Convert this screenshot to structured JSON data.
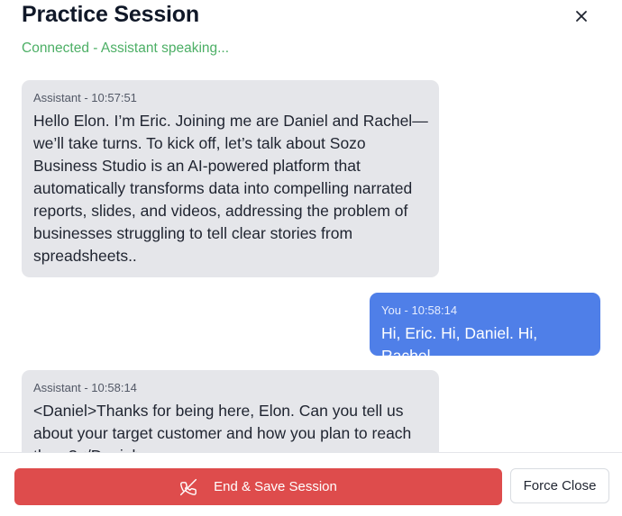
{
  "header": {
    "title": "Practice Session",
    "status": "Connected - Assistant speaking..."
  },
  "messages": [
    {
      "role": "assistant",
      "meta": "Assistant - 10:57:51",
      "text": "Hello Elon. I’m Eric. Joining me are Daniel and Rachel—\nwe’ll take turns. To kick off, let’s talk about Sozo\nBusiness Studio is an AI-powered platform that\nautomatically transforms data into compelling narrated\nreports, slides, and videos, addressing the problem of\nbusinesses struggling to tell clear stories from\nspreadsheets.."
    },
    {
      "role": "user",
      "meta": "You - 10:58:14",
      "text": "Hi, Eric. Hi, Daniel. Hi, Rachel."
    },
    {
      "role": "assistant",
      "meta": "Assistant - 10:58:14",
      "text": "<Daniel>Thanks for being here, Elon. Can you tell us\nabout your target customer and how you plan to reach\nthem?</Daniel>"
    }
  ],
  "footer": {
    "end_label": "End & Save Session",
    "force_label": "Force Close"
  },
  "colors": {
    "status_green": "#4caf65",
    "assistant_bubble": "#e5e6ea",
    "user_bubble": "#4f7fe8",
    "end_button": "#de4c4c"
  },
  "icons": {
    "close": "close-icon",
    "end_call": "phone-off-icon"
  }
}
